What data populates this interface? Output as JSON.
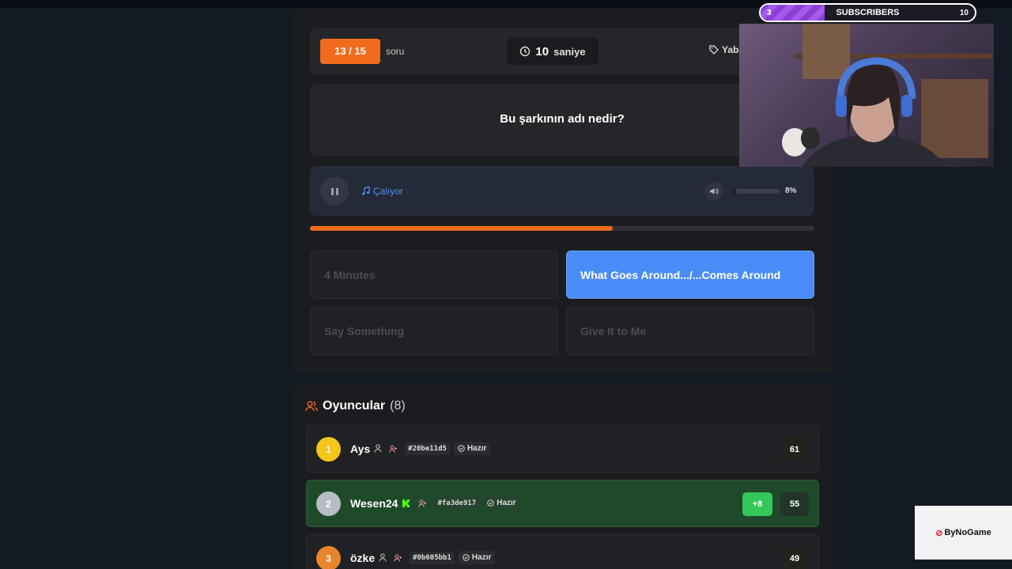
{
  "quiz": {
    "counter": "13 / 15",
    "counter_label": "soru",
    "timer_value": "10",
    "timer_unit": "saniye",
    "category": "Yaba",
    "question": "Bu şarkının adı nedir?",
    "player_status": "Çalıyor",
    "volume_pct": "8%",
    "volume_value": 0.08,
    "progress_value": 0.6,
    "answers": [
      {
        "label": "4 Minutes",
        "selected": false
      },
      {
        "label": "What Goes Around.../...Comes Around",
        "selected": true
      },
      {
        "label": "Say Something",
        "selected": false
      },
      {
        "label": "Give It to Me",
        "selected": false
      }
    ]
  },
  "players": {
    "title": "Oyuncular",
    "count": "(8)",
    "rows": [
      {
        "rank": "1",
        "name": "Ays",
        "code": "#20be11d5",
        "status": "Hazır",
        "score": "61",
        "gain": ""
      },
      {
        "rank": "2",
        "name": "Wesen24",
        "code": "#fa3de917",
        "status": "Hazır",
        "score": "55",
        "gain": "+8"
      },
      {
        "rank": "3",
        "name": "özke",
        "code": "#0b605bb1",
        "status": "Hazır",
        "score": "49",
        "gain": ""
      }
    ]
  },
  "stream": {
    "sub_current": "3",
    "sub_label": "SUBSCRIBERS",
    "sub_goal": "10",
    "sub_progress": 0.3,
    "brand": "ByNoGame"
  },
  "colors": {
    "accent_orange": "#f26b1d",
    "accent_blue": "#4a8cf7",
    "gain_green": "#34c759",
    "gold": "#f5c518",
    "silver": "#b8bcc4",
    "bronze": "#e8852c"
  }
}
